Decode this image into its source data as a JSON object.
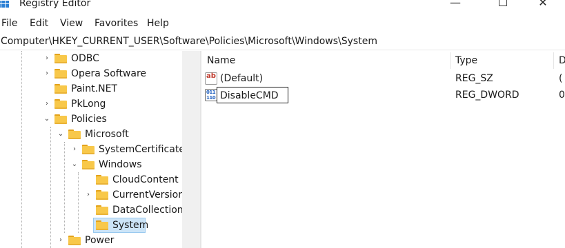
{
  "window": {
    "title": "Registry Editor",
    "controls": {
      "minimize": "—",
      "maximize": "☐",
      "close": "✕"
    }
  },
  "menu": {
    "items": [
      {
        "label": "File"
      },
      {
        "label": "Edit"
      },
      {
        "label": "View"
      },
      {
        "label": "Favorites"
      },
      {
        "label": "Help"
      }
    ]
  },
  "address": {
    "path": "Computer\\HKEY_CURRENT_USER\\Software\\Policies\\Microsoft\\Windows\\System"
  },
  "tree": {
    "items": [
      {
        "label": "ODBC",
        "expander": "›"
      },
      {
        "label": "Opera Software",
        "expander": "›"
      },
      {
        "label": "Paint.NET",
        "expander": ""
      },
      {
        "label": "PkLong",
        "expander": "›"
      },
      {
        "label": "Policies",
        "expander": "⌄"
      },
      {
        "label": "Microsoft",
        "expander": "⌄"
      },
      {
        "label": "SystemCertificates",
        "expander": "›"
      },
      {
        "label": "Windows",
        "expander": "⌄"
      },
      {
        "label": "CloudContent",
        "expander": ""
      },
      {
        "label": "CurrentVersion",
        "expander": "›"
      },
      {
        "label": "DataCollection",
        "expander": ""
      },
      {
        "label": "System",
        "expander": "",
        "selected": true
      },
      {
        "label": "Power",
        "expander": "›"
      }
    ]
  },
  "list": {
    "columns": [
      {
        "label": "Name"
      },
      {
        "label": "Type"
      },
      {
        "label": "D"
      }
    ],
    "rows": [
      {
        "name": "(Default)",
        "type": "REG_SZ",
        "data": "(",
        "icon": "string-value-icon"
      },
      {
        "name": "DisableCMD",
        "type": "REG_DWORD",
        "data": "0",
        "icon": "dword-value-icon",
        "renaming": true
      }
    ]
  },
  "colors": {
    "folder": "#f8c84a",
    "selection": "#cce4f7",
    "app_icon": "#2a7fd4"
  }
}
